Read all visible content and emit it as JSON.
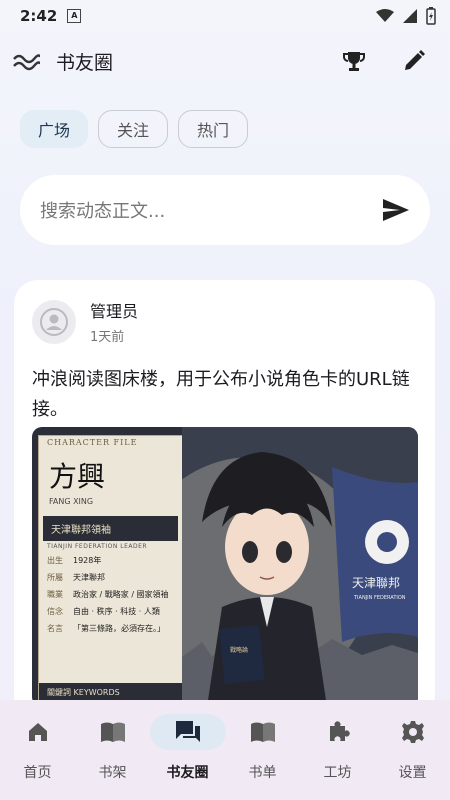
{
  "status": {
    "time": "2:42",
    "a_icon": "A"
  },
  "app_bar": {
    "title": "书友圈",
    "menu_icon": "wave-icon",
    "trophy_icon": "trophy-icon",
    "edit_icon": "pencil-icon"
  },
  "tabs": [
    {
      "label": "广场",
      "active": true
    },
    {
      "label": "关注",
      "active": false
    },
    {
      "label": "热门",
      "active": false
    }
  ],
  "search": {
    "placeholder": "搜索动态正文...",
    "icon": "send-icon"
  },
  "post": {
    "author": "管理员",
    "time": "1天前",
    "content": "冲浪阅读图床楼，用于公布小说角色卡的URL链接。",
    "image": {
      "header": "CHARACTER FILE",
      "name": "方興",
      "pinyin": "FANG XING",
      "title": "天津聯邦領袖",
      "title_en": "TIANJIN FEDERATION LEADER",
      "fields": [
        {
          "label": "出生",
          "value": "1928年"
        },
        {
          "label": "所屬",
          "value": "天津聯邦"
        },
        {
          "label": "職業",
          "value": "政治家 / 戰略家 / 國家領袖"
        },
        {
          "label": "信念",
          "value": "自由 · 秩序 · 科技 · 人類"
        },
        {
          "label": "名言",
          "value": "「第三條路，必須存在。」"
        }
      ],
      "keywords_label": "關鍵詞 KEYWORDS",
      "flag_text": "天津聯邦",
      "flag_sub": "TIANJIN FEDERATION",
      "book_text": "戰略論"
    }
  },
  "nav": [
    {
      "label": "首页",
      "icon": "home-icon",
      "active": false
    },
    {
      "label": "书架",
      "icon": "book-open-icon",
      "active": false
    },
    {
      "label": "书友圈",
      "icon": "chat-icon",
      "active": true
    },
    {
      "label": "书单",
      "icon": "booklist-icon",
      "active": false
    },
    {
      "label": "工坊",
      "icon": "puzzle-icon",
      "active": false
    },
    {
      "label": "设置",
      "icon": "gear-icon",
      "active": false
    }
  ],
  "colors": {
    "accent_chip": "#e3edf6",
    "nav_bg": "#f1e9f4",
    "active_nav": "#dfe9f3"
  }
}
